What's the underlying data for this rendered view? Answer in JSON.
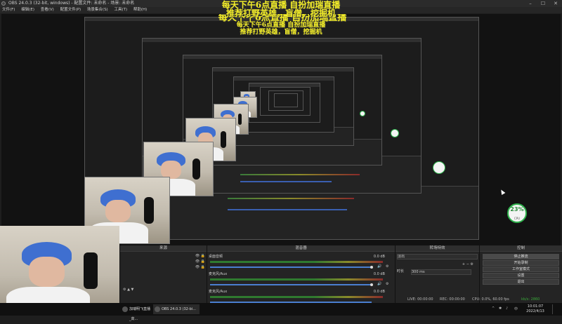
{
  "window": {
    "title": "OBS 24.0.3 (32-bit, windows) - 配置文件: 未命名 - 场景: 未命名",
    "controls": [
      "–",
      "☐",
      "✕"
    ]
  },
  "menu": [
    "文件(F)",
    "编辑(E)",
    "查看(V)",
    "配置文件(P)",
    "场景集合(S)",
    "工具(T)",
    "帮助(H)"
  ],
  "overlay": {
    "line1": "每天下午6点直播 自扮加瑞直播",
    "line2": "推荐打野英雄，盲僧，挖掘机"
  },
  "badge": {
    "value": "23",
    "unit": "%",
    "sub": "CPU"
  },
  "docks": {
    "sources": {
      "title": "来源",
      "items": [
        "",
        "",
        ""
      ]
    },
    "mixer": {
      "title": "混音器",
      "channels": [
        {
          "name": "桌面音频",
          "db": "0.0 dB",
          "level": 0.78
        },
        {
          "name": "麦克风/Aux",
          "db": "0.0 dB",
          "level": 0.6
        },
        {
          "name": "麦克风/Aux",
          "db": "0.0 dB",
          "level": 0.3
        }
      ]
    },
    "transitions": {
      "title": "转场特效",
      "type": "淡出",
      "duration_label": "时长",
      "duration": "300 ms",
      "plus": "+",
      "minus": "−"
    },
    "controls": {
      "title": "控制",
      "buttons": [
        "停止推流",
        "开始录制",
        "工作室模式",
        "设置",
        "退出"
      ]
    }
  },
  "status": {
    "live": "LIVE: 00:00:00",
    "rec": "REC: 00:00:00",
    "cpu": "CPU: 0.0%, 60.00 fps",
    "kbps": "kb/s: 2860"
  },
  "taskbar": {
    "items": [
      "加瑞明飞直播_高...",
      "OBS 24.0.3 (32-bi..."
    ],
    "tray_icons": [
      "^",
      "✱",
      "♪",
      "中"
    ],
    "time": "10:01:07",
    "date": "2022/4/13"
  }
}
